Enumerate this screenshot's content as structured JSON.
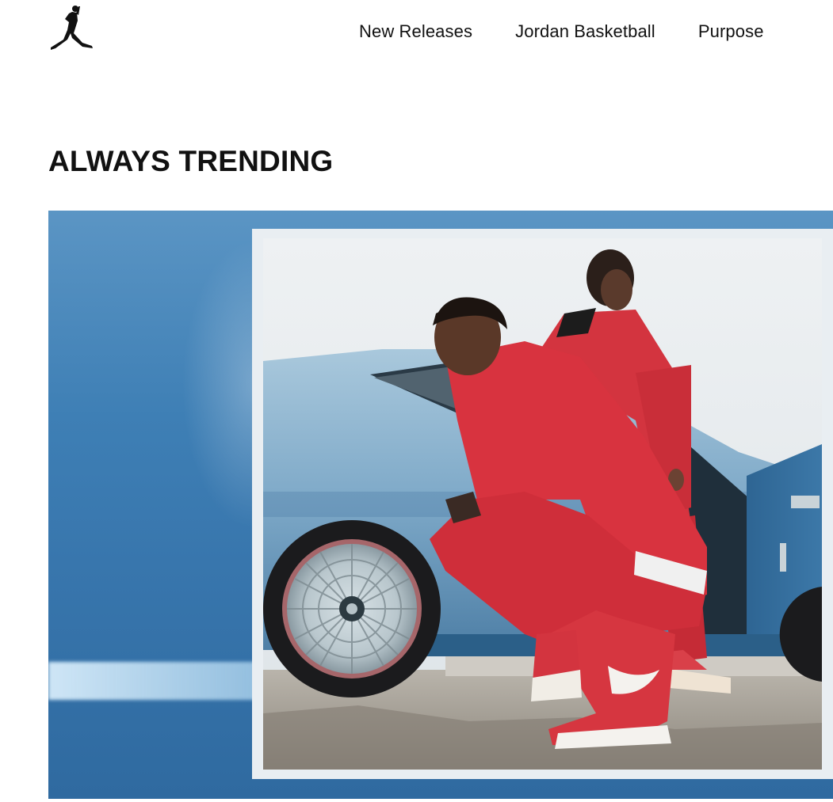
{
  "header": {
    "logo_icon": "jumpman-logo-icon",
    "nav": [
      {
        "label": "New Releases"
      },
      {
        "label": "Jordan Basketball"
      },
      {
        "label": "Purpose"
      }
    ]
  },
  "section": {
    "title": "ALWAYS TRENDING"
  },
  "hero": {
    "image_icon": "hero-photo"
  },
  "colors": {
    "text": "#111111",
    "hero_blue": "#3e7fb5",
    "hoodie_red": "#d8333f",
    "car_blue": "#8fb7d3"
  }
}
